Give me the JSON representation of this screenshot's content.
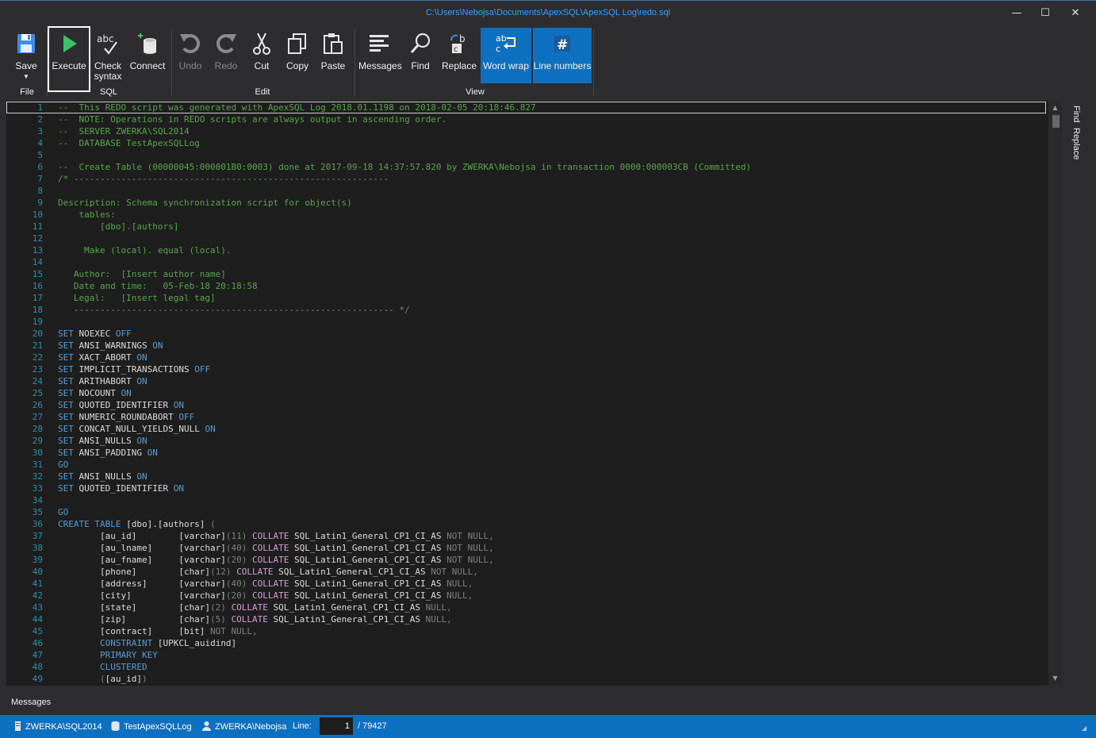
{
  "window": {
    "title": "C:\\Users\\Nebojsa\\Documents\\ApexSQL\\ApexSQL Log\\redo.sql",
    "minimize": "—",
    "maximize": "☐",
    "close": "✕"
  },
  "ribbon": {
    "save": "Save",
    "execute": "Execute",
    "check_syntax": "Check syntax",
    "connect": "Connect",
    "undo": "Undo",
    "redo": "Redo",
    "cut": "Cut",
    "copy": "Copy",
    "paste": "Paste",
    "messages": "Messages",
    "find": "Find",
    "replace": "Replace",
    "word_wrap": "Word wrap",
    "line_numbers": "Line numbers",
    "groups": {
      "file": "File",
      "sql": "SQL",
      "edit": "Edit",
      "view": "View"
    }
  },
  "editor": {
    "lines": [
      [
        [
          "c",
          "--  This REDO script was generated with ApexSQL Log 2018.01.1198 on 2018-02-05 20:18:46.827"
        ]
      ],
      [
        [
          "c",
          "--  NOTE: Operations in REDO scripts are always output in ascending order."
        ]
      ],
      [
        [
          "c",
          "--  SERVER ZWERKA\\SQL2014"
        ]
      ],
      [
        [
          "c",
          "--  DATABASE TestApexSQLLog"
        ]
      ],
      [],
      [
        [
          "c",
          "--  Create Table (00000045:000001B0:0003) done at 2017-09-18 14:37:57.820 by ZWERKA\\Nebojsa in transaction 0000:000003CB (Committed)"
        ]
      ],
      [
        [
          "c",
          "/* ------------------------------------------------------------"
        ]
      ],
      [],
      [
        [
          "c",
          "Description: Schema synchronization script for object(s)"
        ]
      ],
      [
        [
          "c",
          "    tables:"
        ]
      ],
      [
        [
          "c",
          "        [dbo].[authors]"
        ]
      ],
      [],
      [
        [
          "c",
          "     Make (local). equal (local)."
        ]
      ],
      [],
      [
        [
          "c",
          "   Author:  [Insert author name]"
        ]
      ],
      [
        [
          "c",
          "   Date and time:   05-Feb-18 20:18:58"
        ]
      ],
      [
        [
          "c",
          "   Legal:   [Insert legal tag]"
        ]
      ],
      [
        [
          "c",
          "   ------------------------------------------------------------- */"
        ]
      ],
      [],
      [
        [
          "k",
          "SET "
        ],
        [
          "t",
          "NOEXEC "
        ],
        [
          "k",
          "OFF"
        ]
      ],
      [
        [
          "k",
          "SET "
        ],
        [
          "t",
          "ANSI_WARNINGS "
        ],
        [
          "k",
          "ON"
        ]
      ],
      [
        [
          "k",
          "SET "
        ],
        [
          "t",
          "XACT_ABORT "
        ],
        [
          "k",
          "ON"
        ]
      ],
      [
        [
          "k",
          "SET "
        ],
        [
          "t",
          "IMPLICIT_TRANSACTIONS "
        ],
        [
          "k",
          "OFF"
        ]
      ],
      [
        [
          "k",
          "SET "
        ],
        [
          "t",
          "ARITHABORT "
        ],
        [
          "k",
          "ON"
        ]
      ],
      [
        [
          "k",
          "SET "
        ],
        [
          "t",
          "NOCOUNT "
        ],
        [
          "k",
          "ON"
        ]
      ],
      [
        [
          "k",
          "SET "
        ],
        [
          "t",
          "QUOTED_IDENTIFIER "
        ],
        [
          "k",
          "ON"
        ]
      ],
      [
        [
          "k",
          "SET "
        ],
        [
          "t",
          "NUMERIC_ROUNDABORT "
        ],
        [
          "k",
          "OFF"
        ]
      ],
      [
        [
          "k",
          "SET "
        ],
        [
          "t",
          "CONCAT_NULL_YIELDS_NULL "
        ],
        [
          "k",
          "ON"
        ]
      ],
      [
        [
          "k",
          "SET "
        ],
        [
          "t",
          "ANSI_NULLS "
        ],
        [
          "k",
          "ON"
        ]
      ],
      [
        [
          "k",
          "SET "
        ],
        [
          "t",
          "ANSI_PADDING "
        ],
        [
          "k",
          "ON"
        ]
      ],
      [
        [
          "k",
          "GO"
        ]
      ],
      [
        [
          "k",
          "SET "
        ],
        [
          "t",
          "ANSI_NULLS "
        ],
        [
          "k",
          "ON"
        ]
      ],
      [
        [
          "k",
          "SET "
        ],
        [
          "t",
          "QUOTED_IDENTIFIER "
        ],
        [
          "k",
          "ON"
        ]
      ],
      [],
      [
        [
          "k",
          "GO"
        ]
      ],
      [
        [
          "k",
          "CREATE TABLE "
        ],
        [
          "t",
          "[dbo].[authors] "
        ],
        [
          "g",
          "("
        ]
      ],
      [
        [
          "t",
          "        [au_id]        [varchar]"
        ],
        [
          "g",
          "(11) "
        ],
        [
          "f",
          "COLLATE "
        ],
        [
          "t",
          "SQL_Latin1_General_CP1_CI_AS "
        ],
        [
          "g",
          "NOT NULL,"
        ]
      ],
      [
        [
          "t",
          "        [au_lname]     [varchar]"
        ],
        [
          "g",
          "(40) "
        ],
        [
          "f",
          "COLLATE "
        ],
        [
          "t",
          "SQL_Latin1_General_CP1_CI_AS "
        ],
        [
          "g",
          "NOT NULL,"
        ]
      ],
      [
        [
          "t",
          "        [au_fname]     [varchar]"
        ],
        [
          "g",
          "(20) "
        ],
        [
          "f",
          "COLLATE "
        ],
        [
          "t",
          "SQL_Latin1_General_CP1_CI_AS "
        ],
        [
          "g",
          "NOT NULL,"
        ]
      ],
      [
        [
          "t",
          "        [phone]        [char]"
        ],
        [
          "g",
          "(12) "
        ],
        [
          "f",
          "COLLATE "
        ],
        [
          "t",
          "SQL_Latin1_General_CP1_CI_AS "
        ],
        [
          "g",
          "NOT NULL,"
        ]
      ],
      [
        [
          "t",
          "        [address]      [varchar]"
        ],
        [
          "g",
          "(40) "
        ],
        [
          "f",
          "COLLATE "
        ],
        [
          "t",
          "SQL_Latin1_General_CP1_CI_AS "
        ],
        [
          "g",
          "NULL,"
        ]
      ],
      [
        [
          "t",
          "        [city]         [varchar]"
        ],
        [
          "g",
          "(20) "
        ],
        [
          "f",
          "COLLATE "
        ],
        [
          "t",
          "SQL_Latin1_General_CP1_CI_AS "
        ],
        [
          "g",
          "NULL,"
        ]
      ],
      [
        [
          "t",
          "        [state]        [char]"
        ],
        [
          "g",
          "(2) "
        ],
        [
          "f",
          "COLLATE "
        ],
        [
          "t",
          "SQL_Latin1_General_CP1_CI_AS "
        ],
        [
          "g",
          "NULL,"
        ]
      ],
      [
        [
          "t",
          "        [zip]          [char]"
        ],
        [
          "g",
          "(5) "
        ],
        [
          "f",
          "COLLATE "
        ],
        [
          "t",
          "SQL_Latin1_General_CP1_CI_AS "
        ],
        [
          "g",
          "NULL,"
        ]
      ],
      [
        [
          "t",
          "        [contract]     [bit] "
        ],
        [
          "g",
          "NOT NULL,"
        ]
      ],
      [
        [
          "k",
          "        CONSTRAINT "
        ],
        [
          "t",
          "[UPKCL_auidind]"
        ]
      ],
      [
        [
          "k",
          "        PRIMARY KEY"
        ]
      ],
      [
        [
          "k",
          "        CLUSTERED"
        ]
      ],
      [
        [
          "g",
          "        ("
        ],
        [
          "t",
          "[au_id]"
        ],
        [
          "g",
          ")"
        ]
      ]
    ]
  },
  "side_panel": {
    "find": "Find",
    "replace": "Replace"
  },
  "bottom": {
    "messages_tab": "Messages"
  },
  "status": {
    "server": "ZWERKA\\SQL2014",
    "database": "TestApexSQLLog",
    "user": "ZWERKA\\Nebojsa",
    "line_label": "Line:",
    "line_value": "1",
    "total_lines": "/ 79427"
  }
}
